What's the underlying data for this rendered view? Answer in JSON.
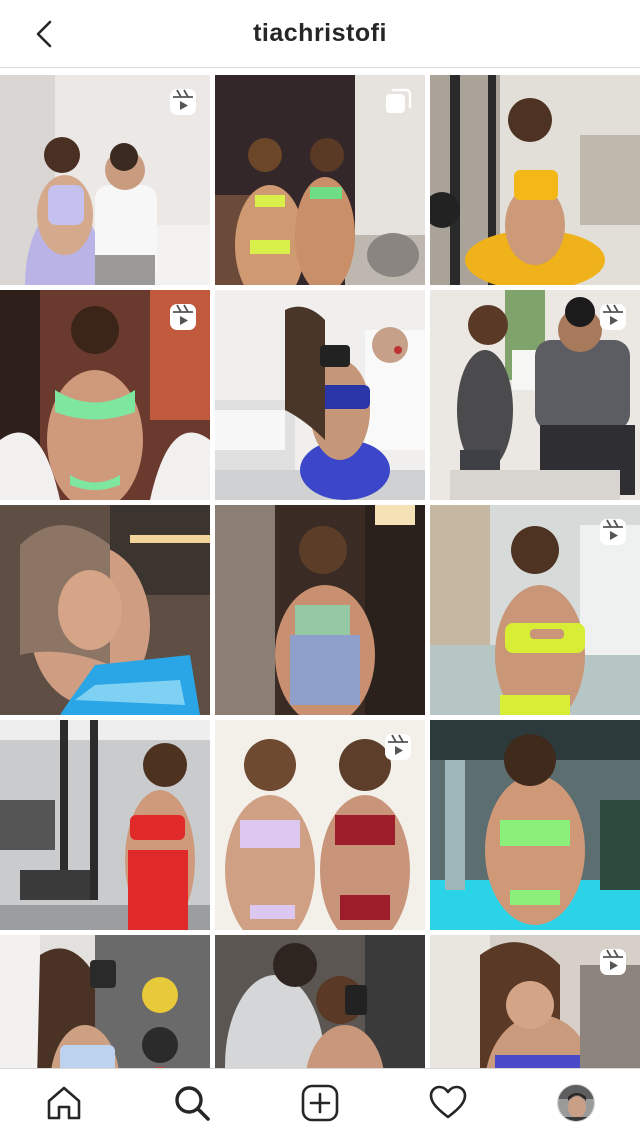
{
  "header": {
    "username": "tiachristofi",
    "back_icon": "chevron-left-icon"
  },
  "grid": {
    "tiles": [
      {
        "index": 1,
        "badge": "reels-icon",
        "bg": "#e9e6e4"
      },
      {
        "index": 2,
        "badge": "carousel-icon",
        "bg": "#3a2c2a"
      },
      {
        "index": 3,
        "badge": null,
        "bg": "#d9d4cc"
      },
      {
        "index": 4,
        "badge": "reels-icon",
        "bg": "#5a2e25"
      },
      {
        "index": 5,
        "badge": null,
        "bg": "#ecebea"
      },
      {
        "index": 6,
        "badge": "reels-icon",
        "bg": "#e7e3de"
      },
      {
        "index": 7,
        "badge": null,
        "bg": "#6b5a4e"
      },
      {
        "index": 8,
        "badge": null,
        "bg": "#3b2d26"
      },
      {
        "index": 9,
        "badge": "reels-icon",
        "bg": "#cdd2d0"
      },
      {
        "index": 10,
        "badge": null,
        "bg": "#bfc1c2"
      },
      {
        "index": 11,
        "badge": "reels-icon",
        "bg": "#f1eee9"
      },
      {
        "index": 12,
        "badge": null,
        "bg": "#7b8f8d"
      },
      {
        "index": 13,
        "badge": null,
        "bg": "#d8d5d2"
      },
      {
        "index": 14,
        "badge": null,
        "bg": "#6e6a66"
      },
      {
        "index": 15,
        "badge": "reels-icon",
        "bg": "#cfc9c2"
      }
    ]
  },
  "tabbar": {
    "items": [
      {
        "name": "home-icon"
      },
      {
        "name": "search-icon",
        "active": true
      },
      {
        "name": "new-post-icon"
      },
      {
        "name": "activity-heart-icon"
      },
      {
        "name": "profile-avatar"
      }
    ]
  },
  "colors": {
    "text": "#262626",
    "divider": "#dbdbdb",
    "background": "#ffffff"
  }
}
